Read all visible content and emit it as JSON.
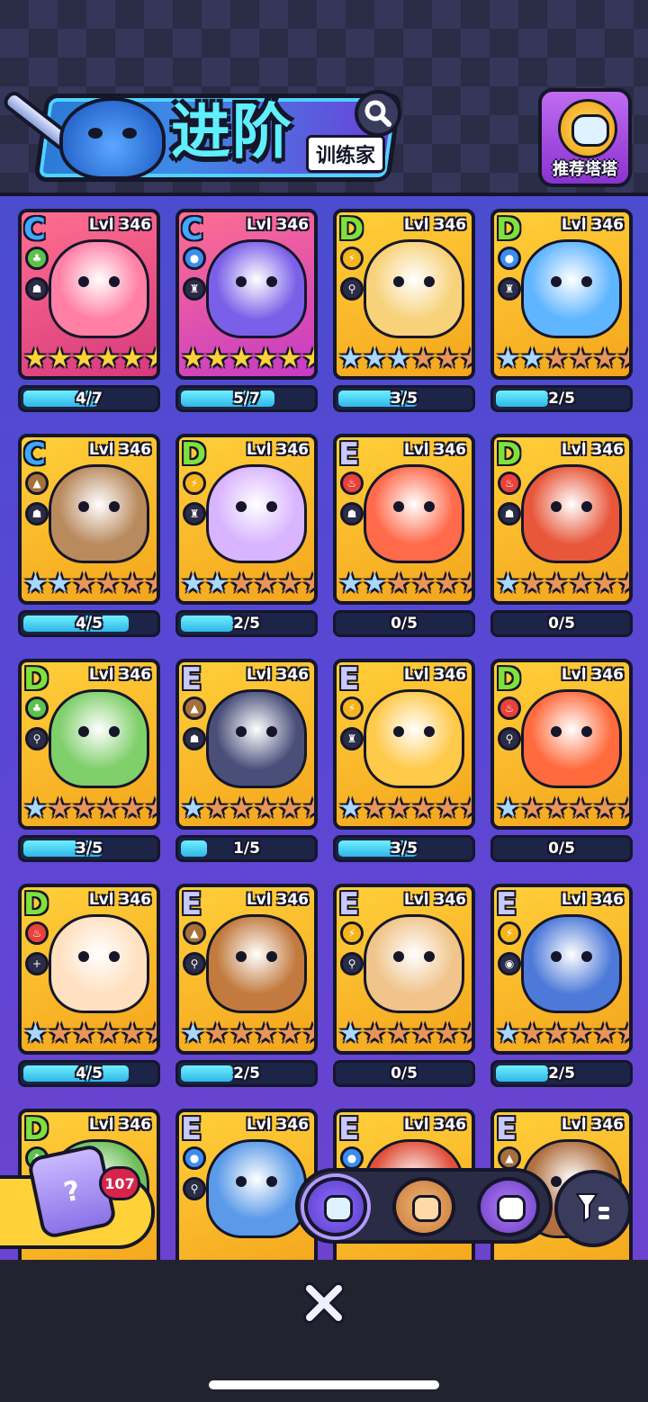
{
  "header": {
    "title": "进阶",
    "subtitle": "训练家",
    "recommend_label": "推荐塔塔"
  },
  "colors": {
    "gold_card": "#f4a51c",
    "grid_bg": "#5a46d4",
    "progress_fill": "#2fb6e8",
    "star_gold": "#ffd23a",
    "star_blue": "#a8d8ff",
    "star_bronze": "#e8955a"
  },
  "cards": [
    {
      "rank": "C",
      "level": "Lvl 346",
      "element": "grass",
      "role": "ghost",
      "stars": [
        "gold",
        "gold",
        "gold",
        "gold",
        "gold",
        "gold"
      ],
      "progress": "4/7",
      "fill": 0.57,
      "art": "#ff7fa5"
    },
    {
      "rank": "C",
      "level": "Lvl 346",
      "element": "water",
      "role": "bag",
      "stars": [
        "gold",
        "gold",
        "gold",
        "gold",
        "gold",
        "gold"
      ],
      "progress": "5/7",
      "fill": 0.71,
      "art": "#7a60e8"
    },
    {
      "rank": "D",
      "level": "Lvl 346",
      "element": "electric",
      "role": "runner",
      "stars": [
        "blue",
        "blue",
        "blue",
        "bronze",
        "bronze",
        "bronze"
      ],
      "progress": "3/5",
      "fill": 0.6,
      "art": "#f7d27a"
    },
    {
      "rank": "D",
      "level": "Lvl 346",
      "element": "water",
      "role": "bag",
      "stars": [
        "blue",
        "blue",
        "bronze",
        "bronze",
        "bronze",
        "bronze"
      ],
      "progress": "2/5",
      "fill": 0.4,
      "art": "#5fb5ff"
    },
    {
      "rank": "C",
      "level": "Lvl 346",
      "element": "earth",
      "role": "ghost",
      "stars": [
        "blue",
        "blue",
        "bronze",
        "bronze",
        "bronze",
        "bronze"
      ],
      "progress": "4/5",
      "fill": 0.8,
      "art": "#b98a5e"
    },
    {
      "rank": "D",
      "level": "Lvl 346",
      "element": "electric",
      "role": "bag",
      "stars": [
        "blue",
        "blue",
        "bronze",
        "bronze",
        "bronze",
        "bronze"
      ],
      "progress": "2/5",
      "fill": 0.4,
      "art": "#d9b4ff"
    },
    {
      "rank": "E",
      "level": "Lvl 346",
      "element": "fire",
      "role": "ghost",
      "stars": [
        "blue",
        "blue",
        "bronze",
        "bronze",
        "bronze",
        "bronze"
      ],
      "progress": "0/5",
      "fill": 0.0,
      "art": "#ff6a4a"
    },
    {
      "rank": "D",
      "level": "Lvl 346",
      "element": "fire",
      "role": "ghost",
      "stars": [
        "blue",
        "bronze",
        "bronze",
        "bronze",
        "bronze",
        "bronze"
      ],
      "progress": "0/5",
      "fill": 0.0,
      "art": "#e8573a"
    },
    {
      "rank": "D",
      "level": "Lvl 346",
      "element": "grass",
      "role": "runner",
      "stars": [
        "blue",
        "bronze",
        "bronze",
        "bronze",
        "bronze",
        "bronze"
      ],
      "progress": "3/5",
      "fill": 0.6,
      "art": "#7fcf6a"
    },
    {
      "rank": "E",
      "level": "Lvl 346",
      "element": "earth",
      "role": "ghost",
      "stars": [
        "blue",
        "bronze",
        "bronze",
        "bronze",
        "bronze",
        "bronze"
      ],
      "progress": "1/5",
      "fill": 0.2,
      "art": "#4a4f7a"
    },
    {
      "rank": "E",
      "level": "Lvl 346",
      "element": "electric",
      "role": "bag",
      "stars": [
        "blue",
        "bronze",
        "bronze",
        "bronze",
        "bronze",
        "bronze"
      ],
      "progress": "3/5",
      "fill": 0.6,
      "art": "#ffc94a"
    },
    {
      "rank": "D",
      "level": "Lvl 346",
      "element": "fire",
      "role": "runner",
      "stars": [
        "blue",
        "bronze",
        "bronze",
        "bronze",
        "bronze",
        "bronze"
      ],
      "progress": "0/5",
      "fill": 0.0,
      "art": "#ff6b3d"
    },
    {
      "rank": "D",
      "level": "Lvl 346",
      "element": "fire",
      "role": "heal",
      "stars": [
        "blue",
        "bronze",
        "bronze",
        "bronze",
        "bronze",
        "bronze"
      ],
      "progress": "4/5",
      "fill": 0.8,
      "art": "#ffe0c0"
    },
    {
      "rank": "E",
      "level": "Lvl 346",
      "element": "earth",
      "role": "runner",
      "stars": [
        "blue",
        "bronze",
        "bronze",
        "bronze",
        "bronze",
        "bronze"
      ],
      "progress": "2/5",
      "fill": 0.4,
      "art": "#c27a3e"
    },
    {
      "rank": "E",
      "level": "Lvl 346",
      "element": "electric",
      "role": "runner",
      "stars": [
        "blue",
        "bronze",
        "bronze",
        "bronze",
        "bronze",
        "bronze"
      ],
      "progress": "0/5",
      "fill": 0.0,
      "art": "#f0c48a"
    },
    {
      "rank": "E",
      "level": "Lvl 346",
      "element": "electric",
      "role": "eye",
      "stars": [
        "blue",
        "bronze",
        "bronze",
        "bronze",
        "bronze",
        "bronze"
      ],
      "progress": "2/5",
      "fill": 0.4,
      "art": "#4d7ad8"
    },
    {
      "rank": "D",
      "level": "Lvl 346",
      "element": "grass",
      "role": "",
      "stars": [],
      "progress": "",
      "fill": 0.0,
      "art": "#6fbf5a"
    },
    {
      "rank": "E",
      "level": "Lvl 346",
      "element": "water",
      "role": "runner",
      "stars": [],
      "progress": "",
      "fill": 0.0,
      "art": "#5a9ae8"
    },
    {
      "rank": "E",
      "level": "Lvl 346",
      "element": "water",
      "role": "",
      "stars": [],
      "progress": "",
      "fill": 0.0,
      "art": "#e0503a"
    },
    {
      "rank": "E",
      "level": "Lvl 346",
      "element": "earth",
      "role": "",
      "stars": [],
      "progress": "",
      "fill": 0.0,
      "art": "#b07040"
    }
  ],
  "gift": {
    "count": "107"
  },
  "tabs": [
    {
      "name": "tower-tab"
    },
    {
      "name": "pet-tab"
    },
    {
      "name": "badge-tab"
    }
  ]
}
